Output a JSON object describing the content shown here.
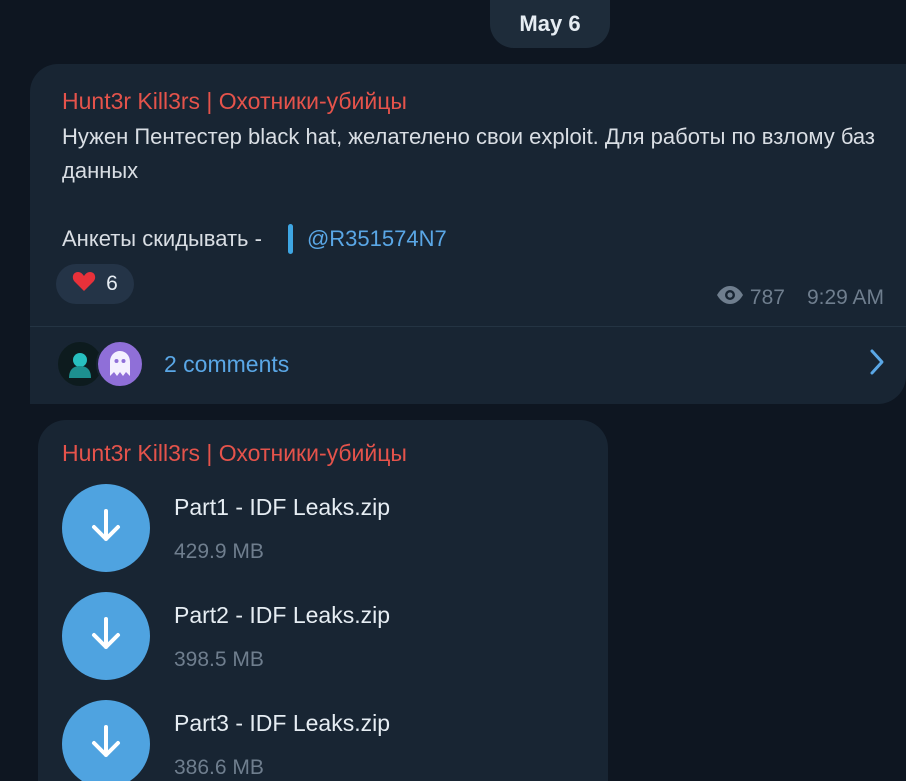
{
  "date_separator": "May 6",
  "post": {
    "channel_name": "Hunt3r Kill3rs | Охотники-убийцы",
    "text": "Нужен Пентестер black hat, желателено свои exploit. Для работы по взлому баз данных",
    "contact_label": "Анкеты скидывать -",
    "contact_handle": "@R351574N7",
    "reaction": {
      "emoji": "heart-icon",
      "count": "6"
    },
    "views": "787",
    "time": "9:29 AM",
    "comments_label": "2 comments"
  },
  "files_message": {
    "channel_name": "Hunt3r Kill3rs | Охотники-убийцы",
    "files": [
      {
        "name": "Part1 - IDF Leaks.zip",
        "size": "429.9 MB"
      },
      {
        "name": "Part2 - IDF Leaks.zip",
        "size": "398.5 MB"
      },
      {
        "name": "Part3 - IDF Leaks.zip",
        "size": "386.6 MB"
      }
    ]
  },
  "colors": {
    "background": "#0e1621",
    "bubble": "#182533",
    "channel_name": "#e5534b",
    "link": "#5aa7e6",
    "download_button": "#4fa3e0",
    "muted": "#6f7e8e"
  }
}
